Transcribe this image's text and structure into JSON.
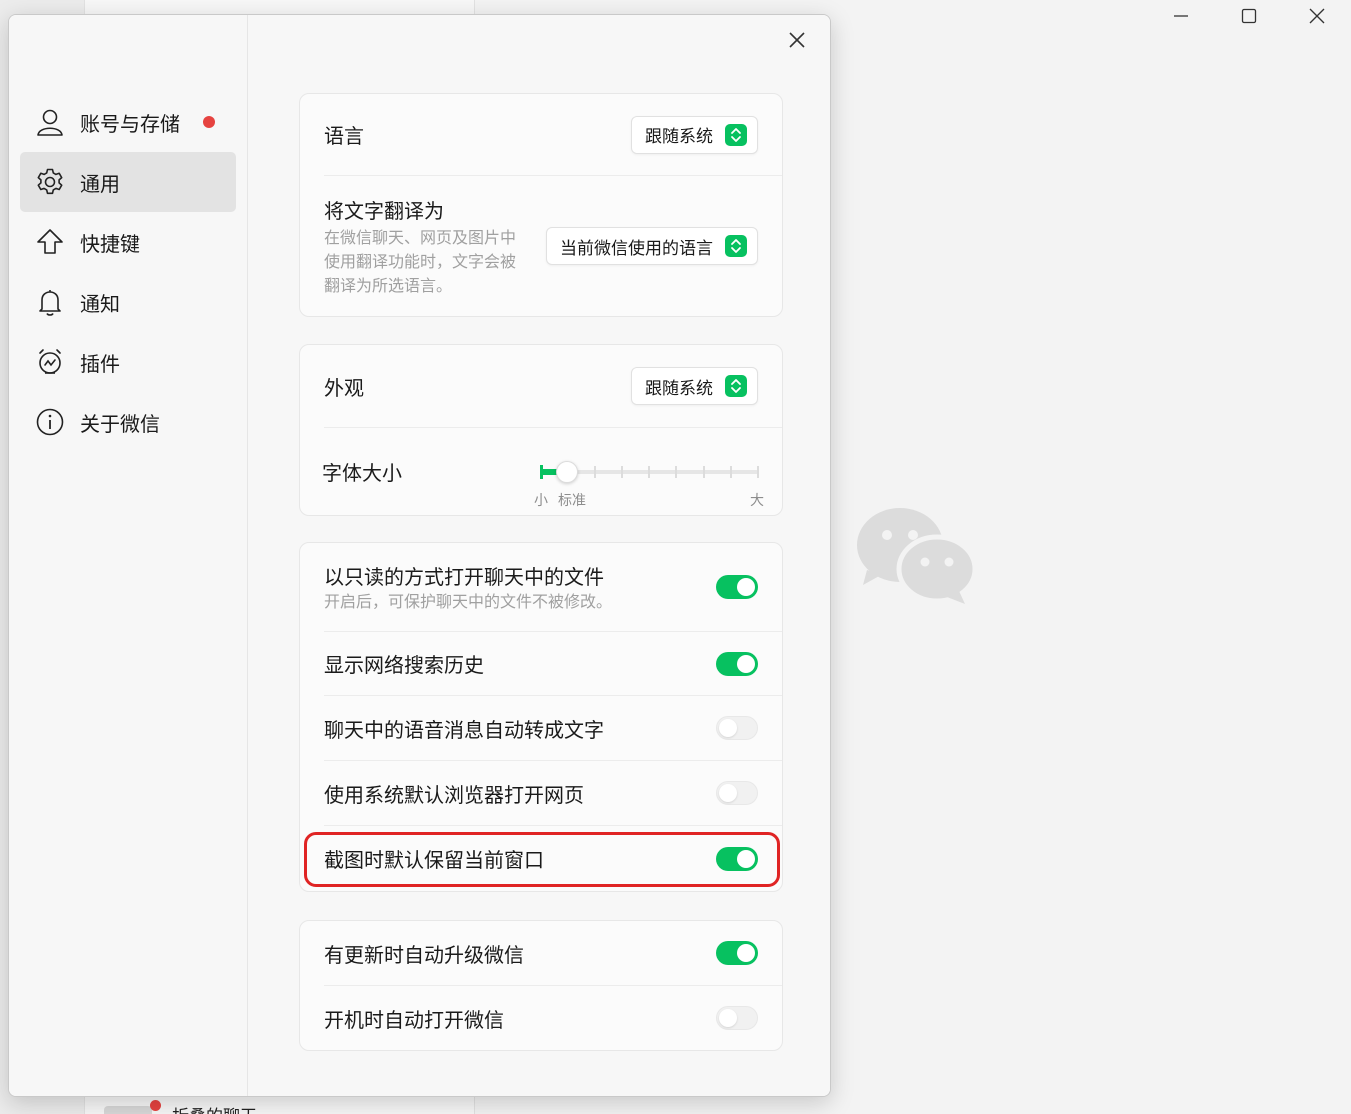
{
  "background": {
    "bottom_text": "折叠的聊天"
  },
  "sidebar": {
    "items": [
      {
        "label": "账号与存储",
        "icon": "person-icon",
        "has_dot": true,
        "active": false
      },
      {
        "label": "通用",
        "icon": "gear-icon",
        "has_dot": false,
        "active": true
      },
      {
        "label": "快捷键",
        "icon": "shortcut-icon",
        "has_dot": false,
        "active": false
      },
      {
        "label": "通知",
        "icon": "bell-icon",
        "has_dot": false,
        "active": false
      },
      {
        "label": "插件",
        "icon": "plugin-icon",
        "has_dot": false,
        "active": false
      },
      {
        "label": "关于微信",
        "icon": "info-icon",
        "has_dot": false,
        "active": false
      }
    ]
  },
  "settings": {
    "language": {
      "title": "语言",
      "value": "跟随系统"
    },
    "translate": {
      "title": "将文字翻译为",
      "desc": "在微信聊天、网页及图片中使用翻译功能时，文字会被翻译为所选语言。",
      "value": "当前微信使用的语言"
    },
    "appearance": {
      "title": "外观",
      "value": "跟随系统"
    },
    "font_size": {
      "title": "字体大小",
      "label_small": "小",
      "label_standard": "标准",
      "label_large": "大",
      "steps": 9,
      "value_step": 1
    },
    "toggles_1": [
      {
        "title": "以只读的方式打开聊天中的文件",
        "desc": "开启后，可保护聊天中的文件不被修改。",
        "on": true
      },
      {
        "title": "显示网络搜索历史",
        "desc": "",
        "on": true
      },
      {
        "title": "聊天中的语音消息自动转成文字",
        "desc": "",
        "on": false
      },
      {
        "title": "使用系统默认浏览器打开网页",
        "desc": "",
        "on": false
      },
      {
        "title": "截图时默认保留当前窗口",
        "desc": "",
        "on": true
      }
    ],
    "toggles_2": [
      {
        "title": "有更新时自动升级微信",
        "on": true
      },
      {
        "title": "开机时自动打开微信",
        "on": false
      }
    ]
  },
  "colors": {
    "accent": "#07c160",
    "highlight": "#e02424",
    "badge": "#e64340"
  }
}
